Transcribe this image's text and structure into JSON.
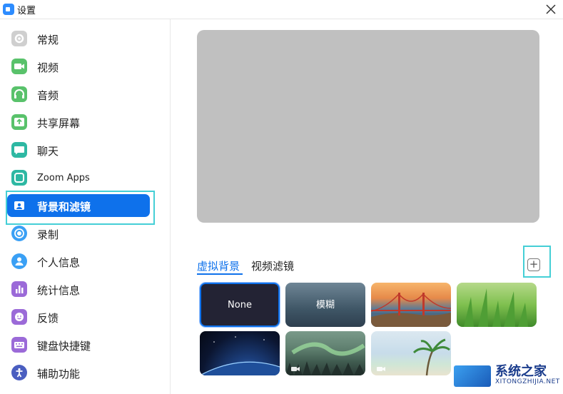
{
  "window": {
    "title": "设置"
  },
  "sidebar": {
    "items": [
      {
        "label": "常规",
        "icon": "gear-icon",
        "color": "#bdbdbd"
      },
      {
        "label": "视频",
        "icon": "video-icon",
        "color": "#59c26b"
      },
      {
        "label": "音频",
        "icon": "headphones-icon",
        "color": "#59c26b"
      },
      {
        "label": "共享屏幕",
        "icon": "share-screen-icon",
        "color": "#59c26b"
      },
      {
        "label": "聊天",
        "icon": "chat-icon",
        "color": "#2eb8a3"
      },
      {
        "label": "Zoom Apps",
        "icon": "apps-icon",
        "color": "#2eb8a3"
      },
      {
        "label": "背景和滤镜",
        "icon": "background-icon",
        "color": "#0e71eb",
        "active": true
      },
      {
        "label": "录制",
        "icon": "record-icon",
        "color": "#3aa0f5"
      },
      {
        "label": "个人信息",
        "icon": "profile-icon",
        "color": "#3aa0f5"
      },
      {
        "label": "统计信息",
        "icon": "statistics-icon",
        "color": "#9b6ad8"
      },
      {
        "label": "反馈",
        "icon": "feedback-icon",
        "color": "#9b6ad8"
      },
      {
        "label": "键盘快捷键",
        "icon": "keyboard-icon",
        "color": "#9b6ad8"
      },
      {
        "label": "辅助功能",
        "icon": "accessibility-icon",
        "color": "#4a5ec0"
      }
    ]
  },
  "main": {
    "tabs": [
      {
        "label": "虚拟背景",
        "active": true
      },
      {
        "label": "视频滤镜",
        "active": false
      }
    ],
    "add_button": "+",
    "backgrounds": [
      {
        "label": "None"
      },
      {
        "label": "模糊"
      },
      {
        "label": ""
      },
      {
        "label": ""
      },
      {
        "label": ""
      },
      {
        "label": ""
      },
      {
        "label": ""
      }
    ]
  },
  "watermark": {
    "text": "系统之家",
    "sub": "XITONGZHIJIA.NET"
  },
  "colors": {
    "accent": "#0e71eb",
    "highlight": "#45cfd6"
  }
}
